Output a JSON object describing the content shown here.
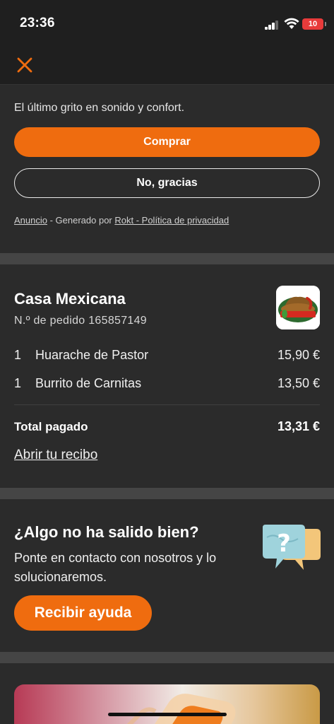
{
  "status_bar": {
    "time": "23:36",
    "battery": "10"
  },
  "top_bar": {
    "close_icon": "close-x-icon"
  },
  "ad": {
    "tagline": "El último grito en sonido y confort.",
    "buy_label": "Comprar",
    "decline_label": "No, gracias",
    "footer": {
      "ad_link": "Anuncio",
      "sep1": " - Generado por ",
      "provider_link": "Rokt - Política de privacidad"
    }
  },
  "order": {
    "restaurant": "Casa Mexicana",
    "order_number": "N.º de pedido 165857149",
    "logo_text": "Casa Mexicana",
    "items": [
      {
        "qty": "1",
        "name": "Huarache de Pastor",
        "price": "15,90 €"
      },
      {
        "qty": "1",
        "name": "Burrito de Carnitas",
        "price": "13,50 €"
      }
    ],
    "total_label": "Total pagado",
    "total_value": "13,31 €",
    "receipt_link": "Abrir tu recibo"
  },
  "help": {
    "title": "¿Algo no ha salido bien?",
    "text": "Ponte en contacto con nosotros y lo solucionaremos.",
    "button": "Recibir ayuda",
    "icon": "question-bubble-icon"
  },
  "colors": {
    "accent": "#ef6c0f",
    "background": "#1f1f1f",
    "card": "#2b2b2b",
    "divider": "#454545"
  }
}
